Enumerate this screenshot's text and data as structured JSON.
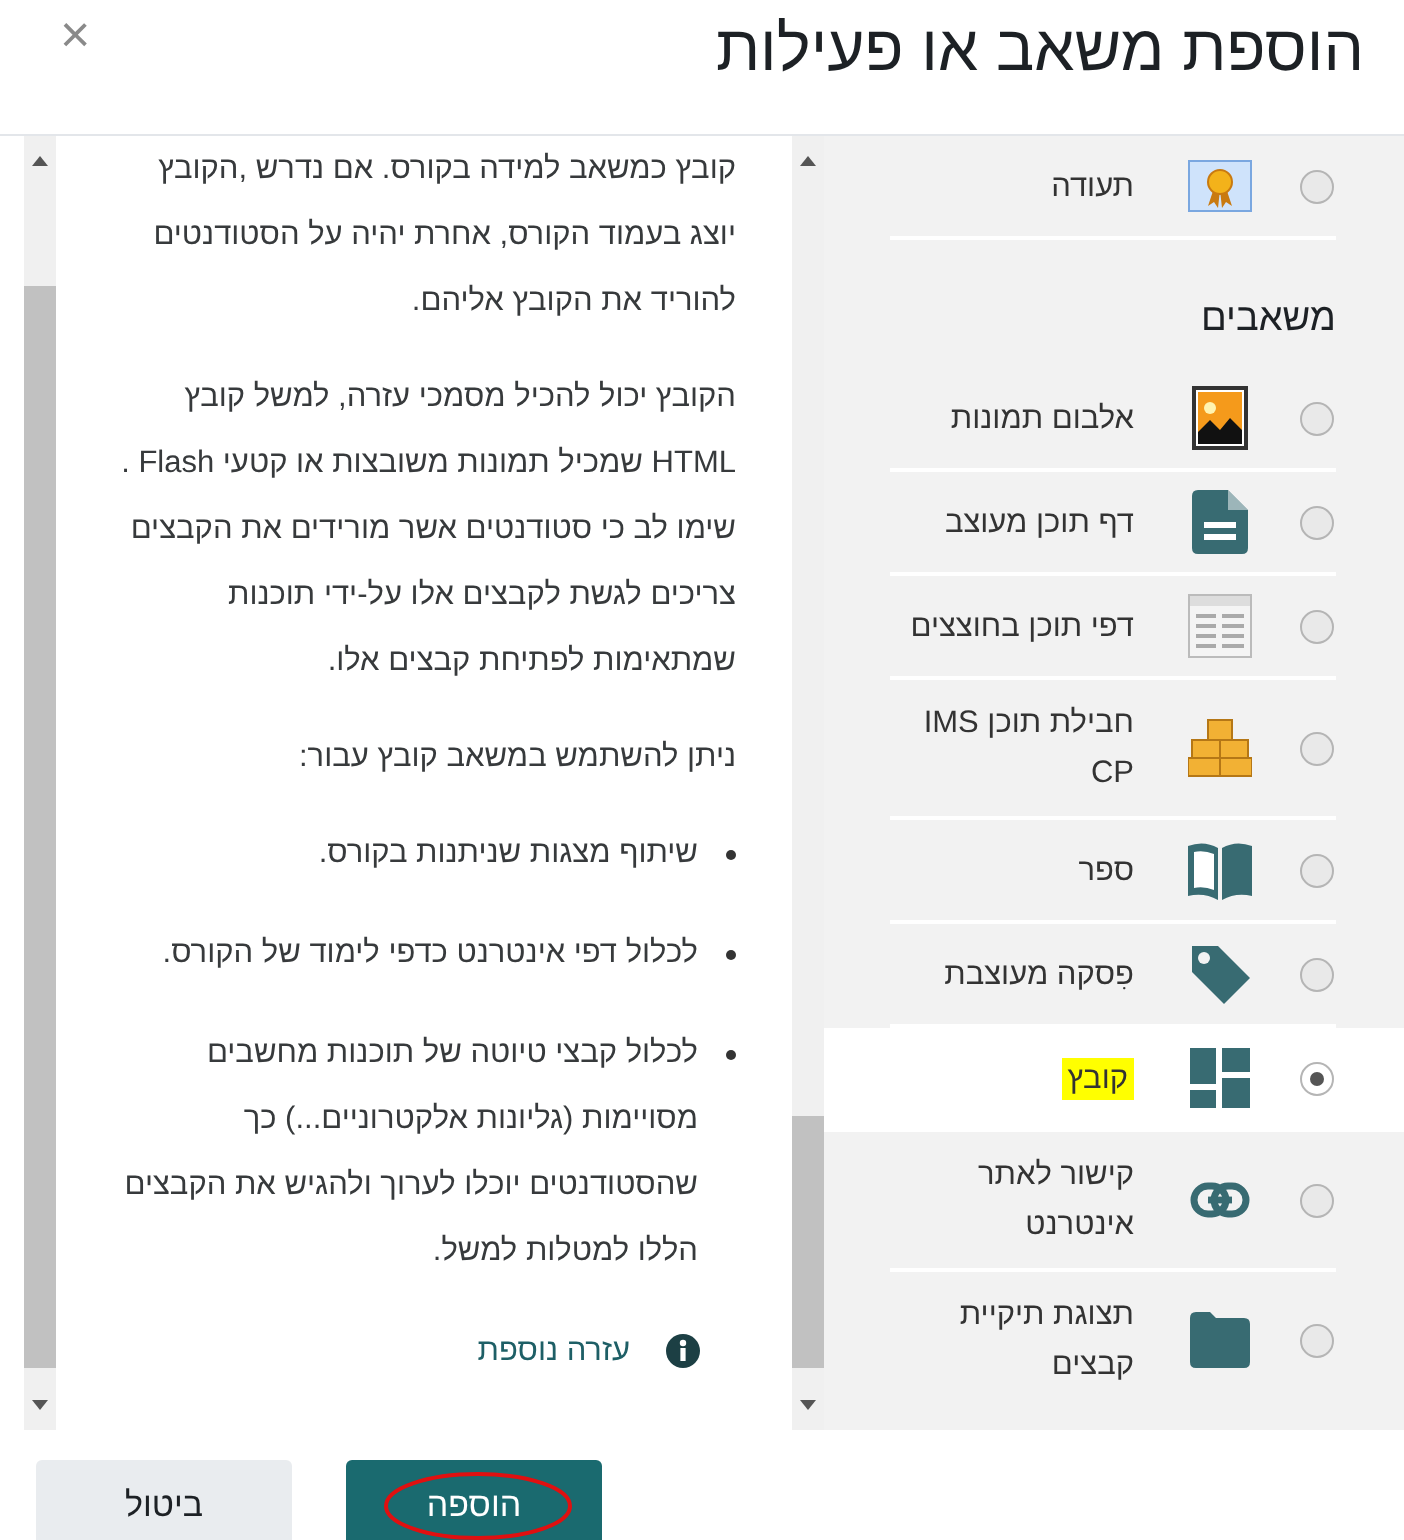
{
  "dialog": {
    "title": "הוספת משאב או פעילות",
    "close": "×"
  },
  "activities_tail": [
    {
      "kind": "certificate",
      "label": "תעודה",
      "selected": false,
      "highlighted": false
    }
  ],
  "resources": {
    "heading": "משאבים",
    "items": [
      {
        "kind": "album",
        "label": "אלבום תמונות",
        "selected": false,
        "highlighted": false
      },
      {
        "kind": "page",
        "label": "דף תוכן מעוצב",
        "selected": false,
        "highlighted": false
      },
      {
        "kind": "tabbed-pages",
        "label": "דפי תוכן בחוצצים",
        "selected": false,
        "highlighted": false
      },
      {
        "kind": "package",
        "label": "חבילת תוכן IMS CP",
        "selected": false,
        "highlighted": false
      },
      {
        "kind": "book",
        "label": "ספר",
        "selected": false,
        "highlighted": false
      },
      {
        "kind": "tag",
        "label": "פִסקה מעוצבת",
        "selected": false,
        "highlighted": false
      },
      {
        "kind": "tiles",
        "label": "קובץ",
        "selected": true,
        "highlighted": true
      },
      {
        "kind": "link",
        "label": "קישור לאתר אינטרנט",
        "selected": false,
        "highlighted": false
      },
      {
        "kind": "folder",
        "label": "תצוגת תיקיית קבצים",
        "selected": false,
        "highlighted": false
      }
    ]
  },
  "help": {
    "paragraphs": [
      "קובץ כמשאב למידה בקורס. אם נדרש ,הקובץ יוצג בעמוד הקורס, אחרת יהיה על הסטודנטים להוריד את הקובץ אליהם.",
      "הקובץ יכול להכיל מסמכי עזרה, למשל קובץ HTML שמכיל תמונות משובצות או קטעי Flash . שימו לב כי סטודנטים אשר מורידים את הקבצים צריכים לגשת לקבצים אלו על-ידי תוכנות שמתאימות לפתיחת קבצים אלו.",
      "ניתן להשתמש במשאב קובץ עבור:"
    ],
    "bullets": [
      "שיתוף מצגות שניתנות בקורס.",
      "לכלול דפי אינטרנט כדפי לימוד של הקורס.",
      "לכלול קבצי טיוטה של תוכנות מחשבים מסויימות (גליונות אלקטרוניים...) כך שהסטודנטים יוכלו לערוך ולהגיש את הקבצים הללו למטלות למשל."
    ],
    "more_help": "עזרה נוספת"
  },
  "buttons": [
    {
      "kind": "primary",
      "label": "הוספה",
      "circled": true
    },
    {
      "kind": "secondary",
      "label": "ביטול",
      "circled": false
    }
  ]
}
